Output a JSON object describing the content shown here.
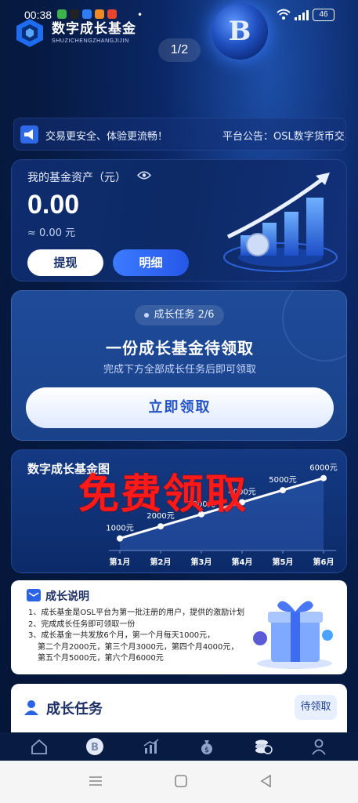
{
  "status_bar": {
    "time": "00:38",
    "battery": "46",
    "mini_icon_colors": [
      "#3bb34a",
      "#222222",
      "#2f7cf6",
      "#f08a24",
      "#e8452c"
    ]
  },
  "header": {
    "brand_cn": "数字成长基金",
    "brand_en": "SHUZICHENGZHANGJIJIN",
    "coin_glyph": "B",
    "pager": "1/2"
  },
  "notice": {
    "icon": "megaphone-icon",
    "text": "交易更安全、体验更流畅！",
    "announcement": "平台公告：OSL数字货币交易"
  },
  "asset": {
    "label": "我的基金资产（元）",
    "amount": "0.00",
    "approx": "≈ 0.00 元",
    "withdraw_label": "提现",
    "detail_label": "明细"
  },
  "task_card": {
    "progress_pill": "成长任务 2/6",
    "progress": {
      "done": 2,
      "total": 6
    },
    "title": "一份成长基金待领取",
    "subtitle": "完成下方全部成长任务后即可领取",
    "claim_label": "立即领取"
  },
  "chart_data": {
    "type": "line",
    "title": "数字成长基金图",
    "categories": [
      "第1月",
      "第2月",
      "第3月",
      "第4月",
      "第5月",
      "第6月"
    ],
    "values": [
      1000,
      2000,
      3000,
      4000,
      5000,
      6000
    ],
    "point_labels": [
      "1000元",
      "2000元",
      "3000元",
      "4000元",
      "5000元",
      "6000元"
    ],
    "ylim": [
      0,
      6500
    ],
    "grid": false
  },
  "overlay": {
    "watermark": "免费领取",
    "watermark_color": "#ff1a1a"
  },
  "explain": {
    "title": "成长说明",
    "lines": [
      "1、成长基金是OSL平台为第一批注册的用户，提供的激励计划",
      "2、完成成长任务即可领取一份",
      "3、成长基金一共发放6个月，第一个月每天1000元，",
      "第二个月2000元，第三个月3000元，第四个月4000元，",
      "第五个月5000元，第六个月6000元"
    ]
  },
  "tasks": {
    "title": "成长任务",
    "status": "待领取"
  },
  "tabbar": {
    "items": [
      "home-icon",
      "bitcoin-icon",
      "market-chart-icon",
      "money-bag-icon",
      "coins-icon",
      "profile-icon"
    ]
  },
  "colors": {
    "accent": "#2e6ae8",
    "background": "#071a3f"
  }
}
